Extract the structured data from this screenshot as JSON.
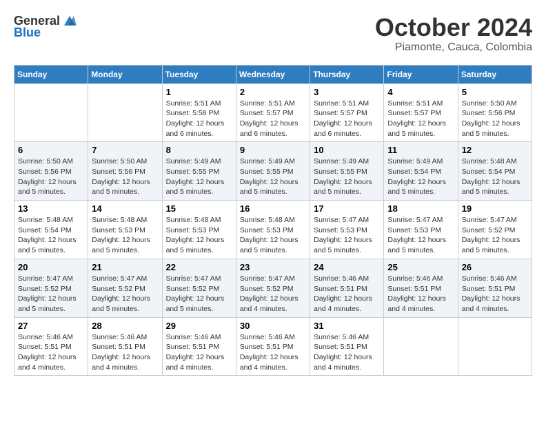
{
  "header": {
    "logo": {
      "text_general": "General",
      "text_blue": "Blue"
    },
    "title": "October 2024",
    "location": "Piamonte, Cauca, Colombia"
  },
  "weekdays": [
    "Sunday",
    "Monday",
    "Tuesday",
    "Wednesday",
    "Thursday",
    "Friday",
    "Saturday"
  ],
  "weeks": [
    [
      {
        "day": "",
        "info": ""
      },
      {
        "day": "",
        "info": ""
      },
      {
        "day": "1",
        "info": "Sunrise: 5:51 AM\nSunset: 5:58 PM\nDaylight: 12 hours\nand 6 minutes."
      },
      {
        "day": "2",
        "info": "Sunrise: 5:51 AM\nSunset: 5:57 PM\nDaylight: 12 hours\nand 6 minutes."
      },
      {
        "day": "3",
        "info": "Sunrise: 5:51 AM\nSunset: 5:57 PM\nDaylight: 12 hours\nand 6 minutes."
      },
      {
        "day": "4",
        "info": "Sunrise: 5:51 AM\nSunset: 5:57 PM\nDaylight: 12 hours\nand 5 minutes."
      },
      {
        "day": "5",
        "info": "Sunrise: 5:50 AM\nSunset: 5:56 PM\nDaylight: 12 hours\nand 5 minutes."
      }
    ],
    [
      {
        "day": "6",
        "info": "Sunrise: 5:50 AM\nSunset: 5:56 PM\nDaylight: 12 hours\nand 5 minutes."
      },
      {
        "day": "7",
        "info": "Sunrise: 5:50 AM\nSunset: 5:56 PM\nDaylight: 12 hours\nand 5 minutes."
      },
      {
        "day": "8",
        "info": "Sunrise: 5:49 AM\nSunset: 5:55 PM\nDaylight: 12 hours\nand 5 minutes."
      },
      {
        "day": "9",
        "info": "Sunrise: 5:49 AM\nSunset: 5:55 PM\nDaylight: 12 hours\nand 5 minutes."
      },
      {
        "day": "10",
        "info": "Sunrise: 5:49 AM\nSunset: 5:55 PM\nDaylight: 12 hours\nand 5 minutes."
      },
      {
        "day": "11",
        "info": "Sunrise: 5:49 AM\nSunset: 5:54 PM\nDaylight: 12 hours\nand 5 minutes."
      },
      {
        "day": "12",
        "info": "Sunrise: 5:48 AM\nSunset: 5:54 PM\nDaylight: 12 hours\nand 5 minutes."
      }
    ],
    [
      {
        "day": "13",
        "info": "Sunrise: 5:48 AM\nSunset: 5:54 PM\nDaylight: 12 hours\nand 5 minutes."
      },
      {
        "day": "14",
        "info": "Sunrise: 5:48 AM\nSunset: 5:53 PM\nDaylight: 12 hours\nand 5 minutes."
      },
      {
        "day": "15",
        "info": "Sunrise: 5:48 AM\nSunset: 5:53 PM\nDaylight: 12 hours\nand 5 minutes."
      },
      {
        "day": "16",
        "info": "Sunrise: 5:48 AM\nSunset: 5:53 PM\nDaylight: 12 hours\nand 5 minutes."
      },
      {
        "day": "17",
        "info": "Sunrise: 5:47 AM\nSunset: 5:53 PM\nDaylight: 12 hours\nand 5 minutes."
      },
      {
        "day": "18",
        "info": "Sunrise: 5:47 AM\nSunset: 5:53 PM\nDaylight: 12 hours\nand 5 minutes."
      },
      {
        "day": "19",
        "info": "Sunrise: 5:47 AM\nSunset: 5:52 PM\nDaylight: 12 hours\nand 5 minutes."
      }
    ],
    [
      {
        "day": "20",
        "info": "Sunrise: 5:47 AM\nSunset: 5:52 PM\nDaylight: 12 hours\nand 5 minutes."
      },
      {
        "day": "21",
        "info": "Sunrise: 5:47 AM\nSunset: 5:52 PM\nDaylight: 12 hours\nand 5 minutes."
      },
      {
        "day": "22",
        "info": "Sunrise: 5:47 AM\nSunset: 5:52 PM\nDaylight: 12 hours\nand 5 minutes."
      },
      {
        "day": "23",
        "info": "Sunrise: 5:47 AM\nSunset: 5:52 PM\nDaylight: 12 hours\nand 4 minutes."
      },
      {
        "day": "24",
        "info": "Sunrise: 5:46 AM\nSunset: 5:51 PM\nDaylight: 12 hours\nand 4 minutes."
      },
      {
        "day": "25",
        "info": "Sunrise: 5:46 AM\nSunset: 5:51 PM\nDaylight: 12 hours\nand 4 minutes."
      },
      {
        "day": "26",
        "info": "Sunrise: 5:46 AM\nSunset: 5:51 PM\nDaylight: 12 hours\nand 4 minutes."
      }
    ],
    [
      {
        "day": "27",
        "info": "Sunrise: 5:46 AM\nSunset: 5:51 PM\nDaylight: 12 hours\nand 4 minutes."
      },
      {
        "day": "28",
        "info": "Sunrise: 5:46 AM\nSunset: 5:51 PM\nDaylight: 12 hours\nand 4 minutes."
      },
      {
        "day": "29",
        "info": "Sunrise: 5:46 AM\nSunset: 5:51 PM\nDaylight: 12 hours\nand 4 minutes."
      },
      {
        "day": "30",
        "info": "Sunrise: 5:46 AM\nSunset: 5:51 PM\nDaylight: 12 hours\nand 4 minutes."
      },
      {
        "day": "31",
        "info": "Sunrise: 5:46 AM\nSunset: 5:51 PM\nDaylight: 12 hours\nand 4 minutes."
      },
      {
        "day": "",
        "info": ""
      },
      {
        "day": "",
        "info": ""
      }
    ]
  ]
}
